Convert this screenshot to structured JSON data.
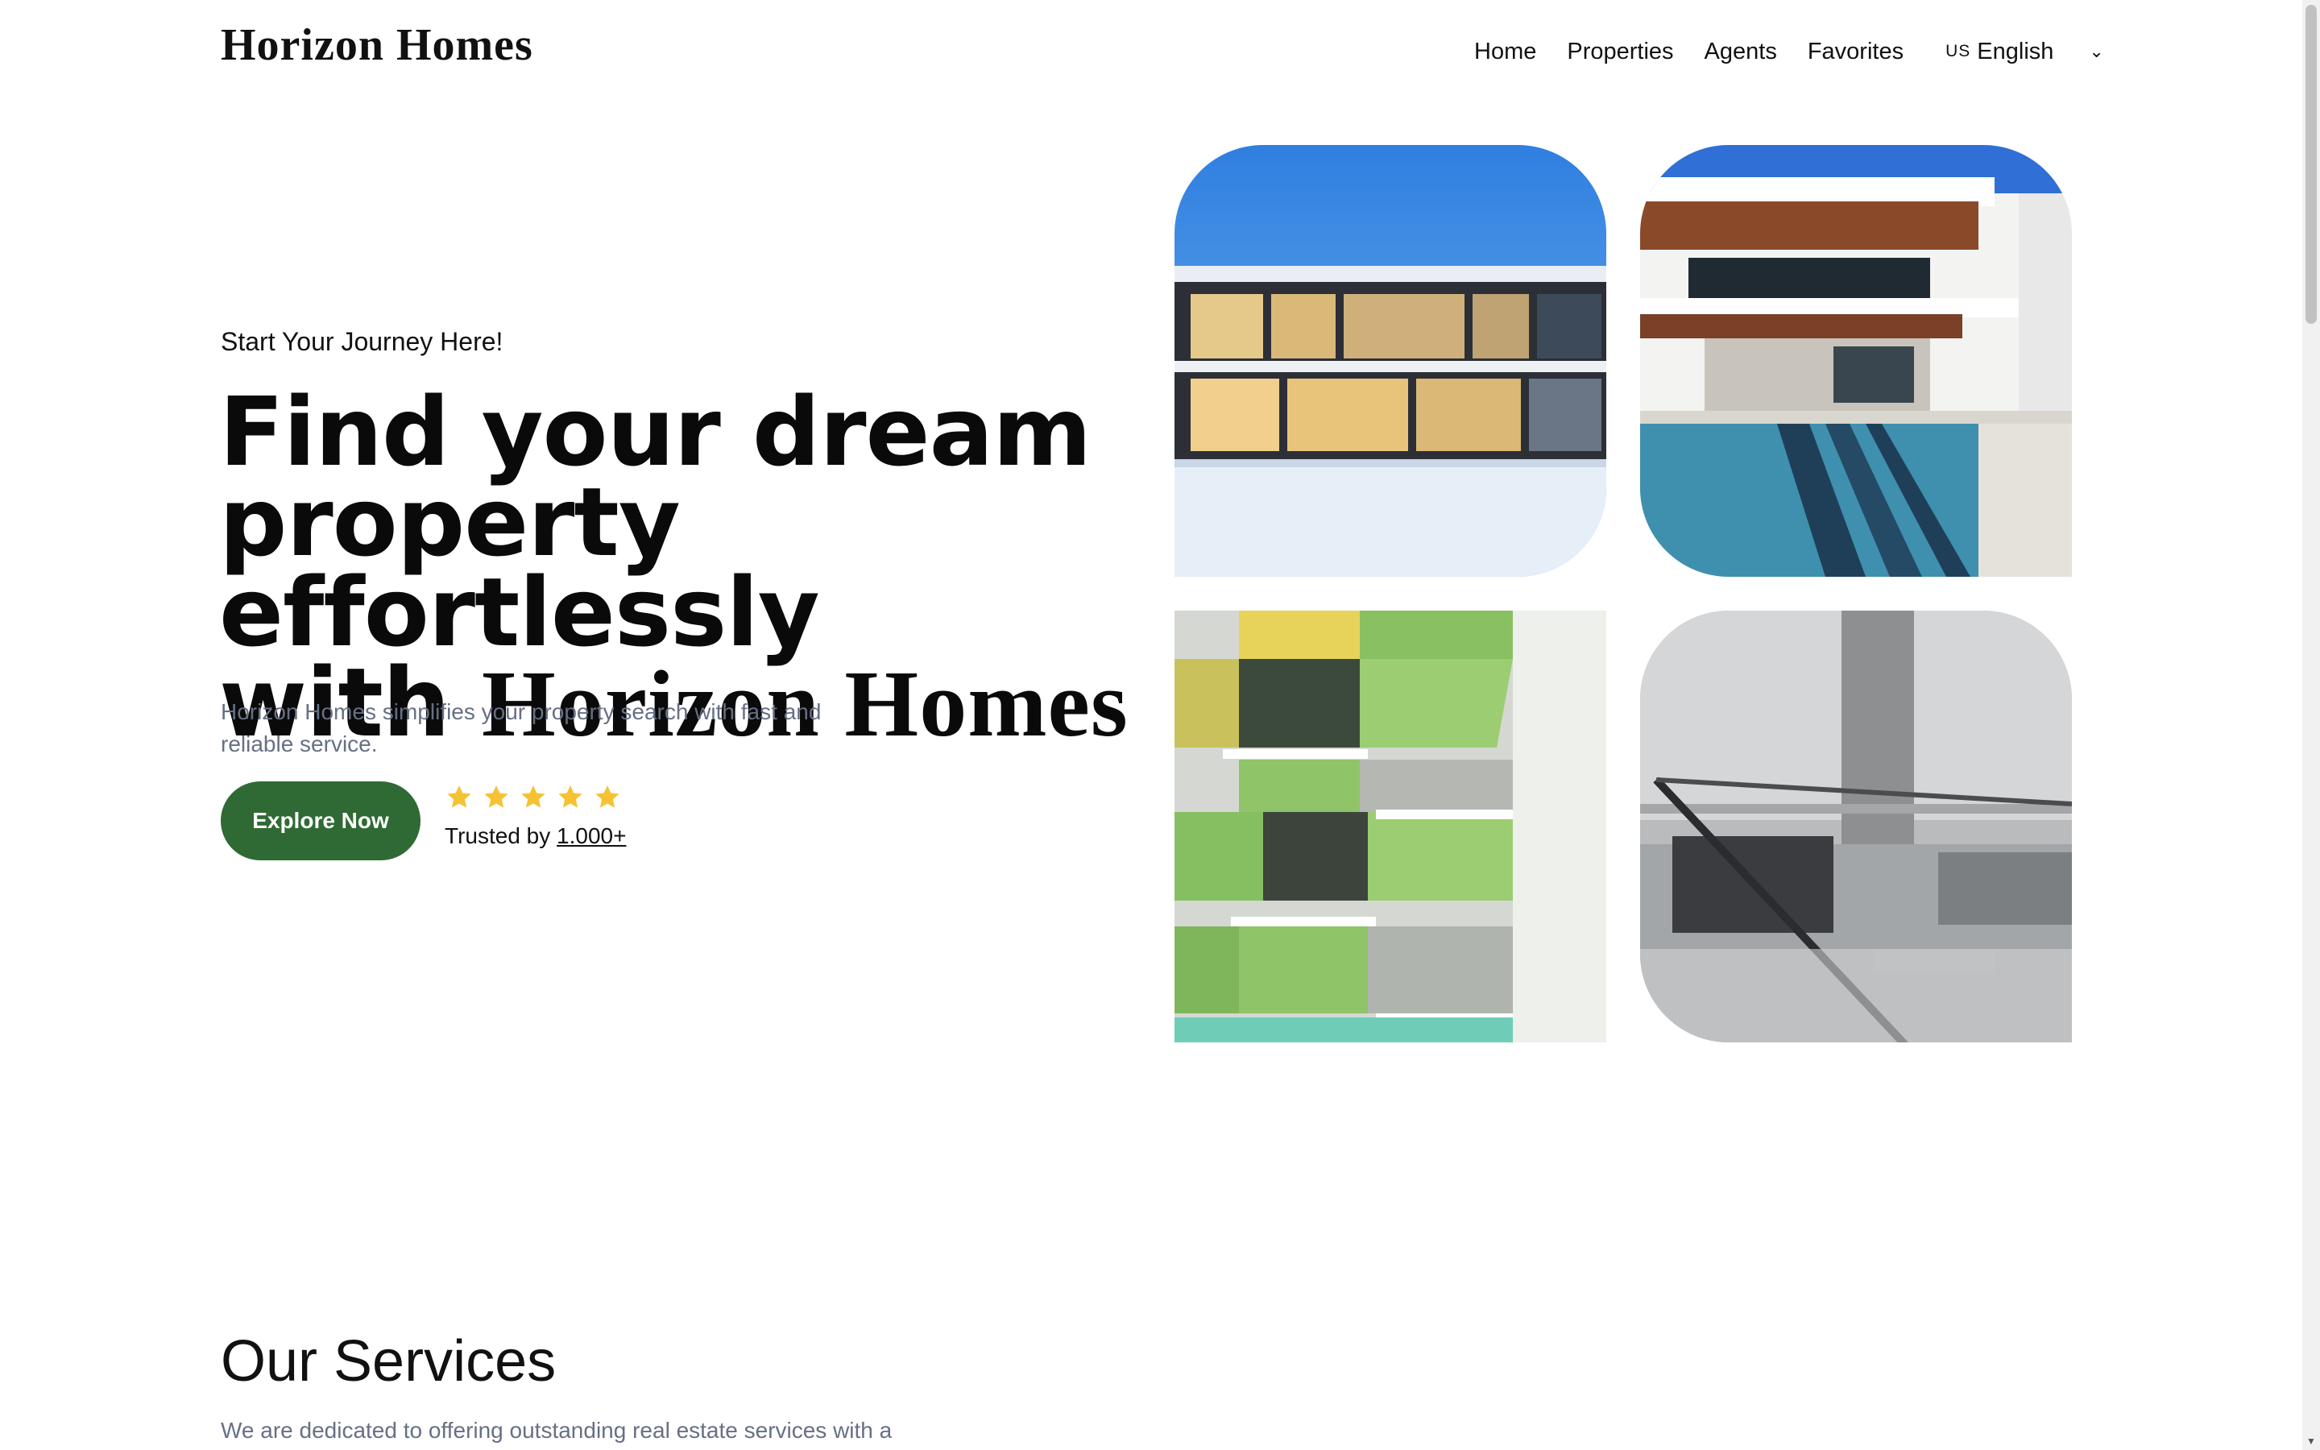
{
  "header": {
    "brand": "Horizon Homes",
    "nav": [
      "Home",
      "Properties",
      "Agents",
      "Favorites"
    ],
    "language": {
      "flag": "US",
      "label": "English"
    }
  },
  "hero": {
    "eyebrow": "Start Your Journey Here!",
    "headline_line1": "Find your dream",
    "headline_line2": "property effortlessly",
    "headline_with": "with",
    "headline_brand": "Horizon Homes",
    "subtext": "Horizon Homes simplifies your property search with fast and reliable service.",
    "cta": "Explore Now",
    "rating_stars": 5,
    "trusted_prefix": "Trusted by",
    "trusted_count": "1.000+"
  },
  "services": {
    "title": "Our Services",
    "description": "We are dedicated to offering outstanding real estate services with a"
  },
  "colors": {
    "accent": "#2f6a35",
    "star": "#f5c233",
    "muted_text": "#667085"
  }
}
